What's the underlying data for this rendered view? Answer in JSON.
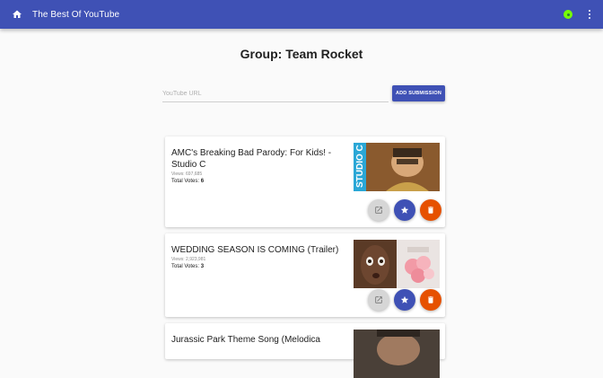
{
  "appbar": {
    "title": "The Best Of YouTube",
    "accent": "#3f51b5"
  },
  "page": {
    "title": "Group: Team Rocket"
  },
  "submission": {
    "placeholder": "YouTube URL",
    "button_label": "ADD SUBMISSION"
  },
  "videos": [
    {
      "title": "AMC's Breaking Bad Parody: For Kids! - Studio C",
      "views": "Views: 697,685",
      "votes_label": "Total Votes:",
      "votes": "6",
      "thumb_text": "STUDIO C"
    },
    {
      "title": "WEDDING SEASON IS COMING (Trailer)",
      "views": "Views: 2,923,981",
      "votes_label": "Total Votes:",
      "votes": "3"
    },
    {
      "title": "Jurassic Park Theme Song (Melodica"
    }
  ],
  "icons": {
    "home": "home-icon",
    "status": "status-dot-icon",
    "more": "more-vert-icon",
    "open": "open-in-new-icon",
    "star": "star-icon",
    "delete": "delete-icon"
  }
}
